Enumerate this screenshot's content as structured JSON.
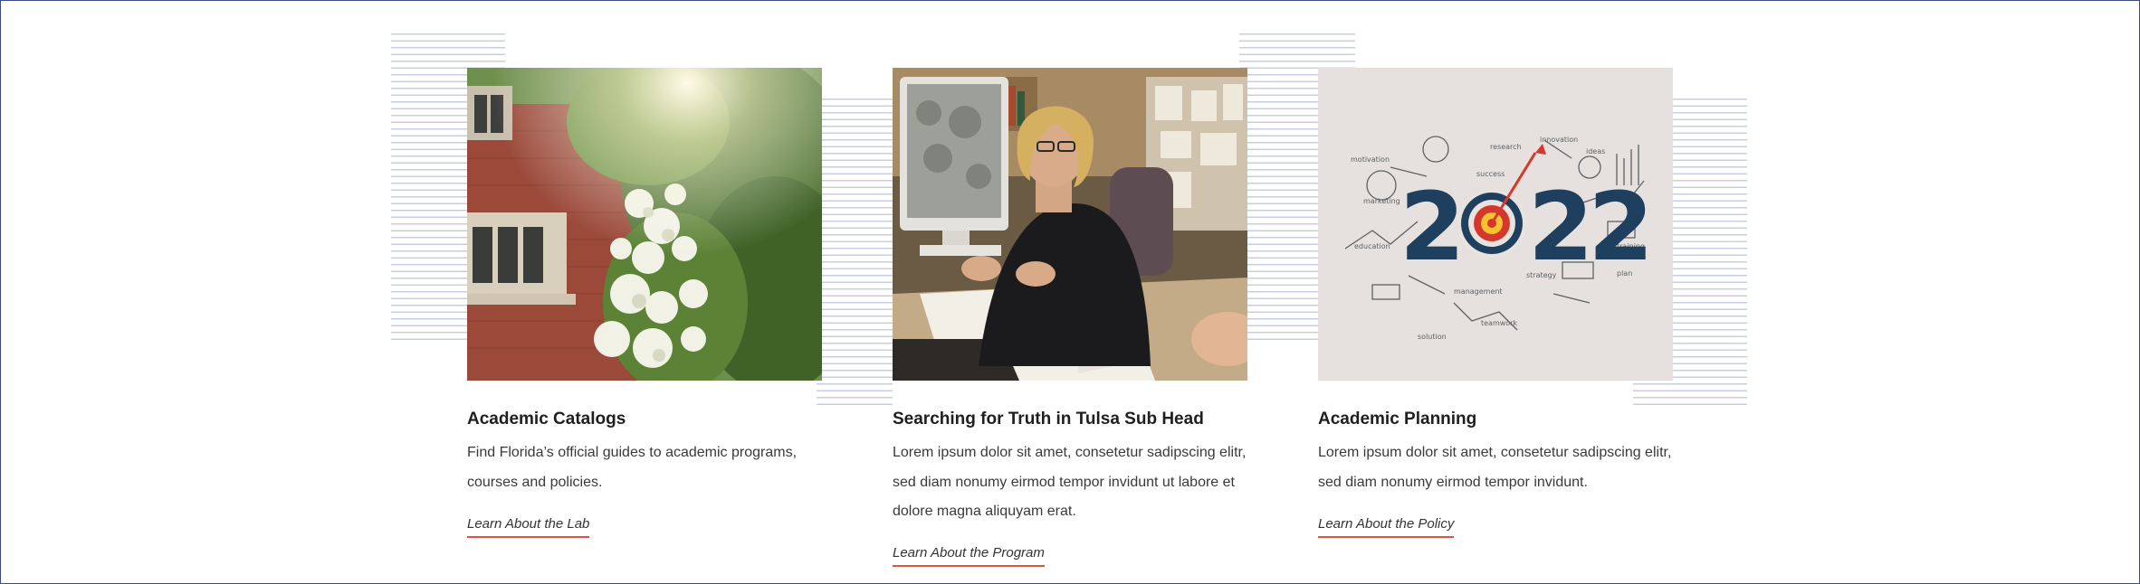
{
  "cards": [
    {
      "title": "Academic Catalogs",
      "description": "Find Florida’s official guides to academic programs, courses and policies.",
      "link": "Learn About the Lab",
      "image": "campus-building-flowers-photo"
    },
    {
      "title": "Searching for Truth in Tulsa Sub Head",
      "description": "Lorem ipsum dolor sit amet, consetetur sadipscing elitr, sed diam nonumy eirmod tempor invidunt ut labore et dolore magna aliquyam erat.",
      "link": "Learn About the Program",
      "image": "researcher-at-desk-photo"
    },
    {
      "title": "Academic Planning",
      "description": "Lorem ipsum dolor sit amet, consetetur sadipscing elitr, sed diam nonumy eirmod tempor invidunt.",
      "link": "Learn About the Policy",
      "image": "2022-goal-sketch-illustration",
      "image_text": "2022"
    }
  ],
  "colors": {
    "link_underline": "#d9574a",
    "line_pattern": "#c9cde2",
    "frame": "#3d4a86"
  }
}
